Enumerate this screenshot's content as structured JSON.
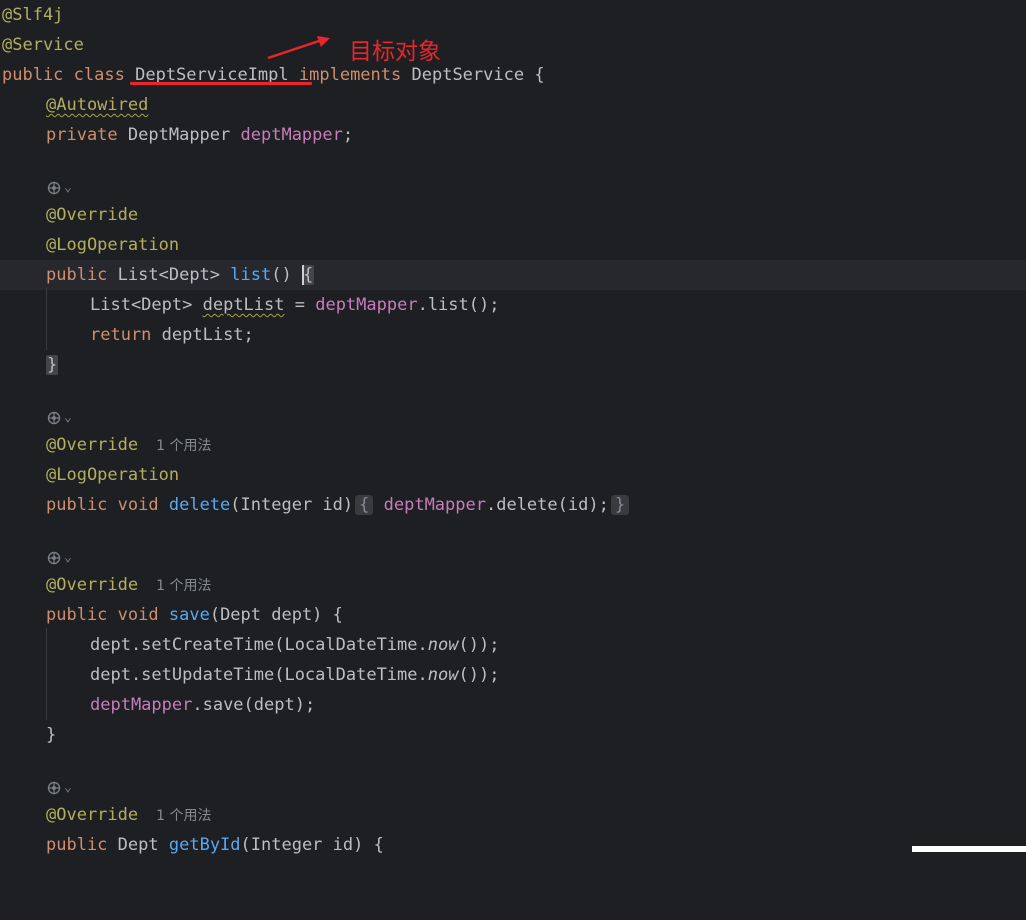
{
  "annotation": {
    "label": "目标对象",
    "color": "#e8262b"
  },
  "colors": {
    "background": "#1e1f22",
    "text": "#bcbec4",
    "keyword": "#cf8e6d",
    "annotation": "#b3ae60",
    "method": "#56a8f5",
    "field": "#c77dbb",
    "hint": "#868a91"
  },
  "code": {
    "l1": {
      "ann": "@Slf4j"
    },
    "l2": {
      "ann": "@Service"
    },
    "l3": {
      "kw1": "public",
      "kw2": "class",
      "name": "DeptServiceImpl",
      "kw3": "implements",
      "iface": "DeptService",
      "brace": "{"
    },
    "l4": {
      "ann": "@Autowired"
    },
    "l5": {
      "kw": "private",
      "type": "DeptMapper",
      "field": "deptMapper",
      "semi": ";"
    },
    "m1": {
      "ann1": "@Override",
      "ann2": "@LogOperation",
      "kw": "public",
      "ret": "List<Dept>",
      "name": "list",
      "params": "()",
      "open": "{",
      "b1_type": "List<Dept>",
      "b1_var": "deptList",
      "b1_eq": " = ",
      "b1_field": "deptMapper",
      "b1_call": ".list();",
      "b2_kw": "return",
      "b2_rest": " deptList;",
      "close": "}"
    },
    "m2": {
      "ann1": "@Override",
      "hint": "1 个用法",
      "ann2": "@LogOperation",
      "kw1": "public",
      "kw2": "void",
      "name": "delete",
      "params": "(Integer id)",
      "open": "{",
      "field": "deptMapper",
      "call": ".delete(id);",
      "close": "}"
    },
    "m3": {
      "ann1": "@Override",
      "hint": "1 个用法",
      "kw1": "public",
      "kw2": "void",
      "name": "save",
      "params": "(Dept dept) {",
      "b1_pre": "dept.setCreateTime(LocalDateTime.",
      "b1_it": "now",
      "b1_post": "());",
      "b2_pre": "dept.setUpdateTime(LocalDateTime.",
      "b2_it": "now",
      "b2_post": "());",
      "b3_field": "deptMapper",
      "b3_call": ".save(dept);",
      "close": "}"
    },
    "m4": {
      "ann1": "@Override",
      "hint": "1 个用法",
      "kw": "public",
      "ret": "Dept",
      "name": "getById",
      "params": "(Integer id) {"
    }
  },
  "icons": {
    "gutter": "implements-marker-icon",
    "chevron": "chevron-down-icon"
  }
}
